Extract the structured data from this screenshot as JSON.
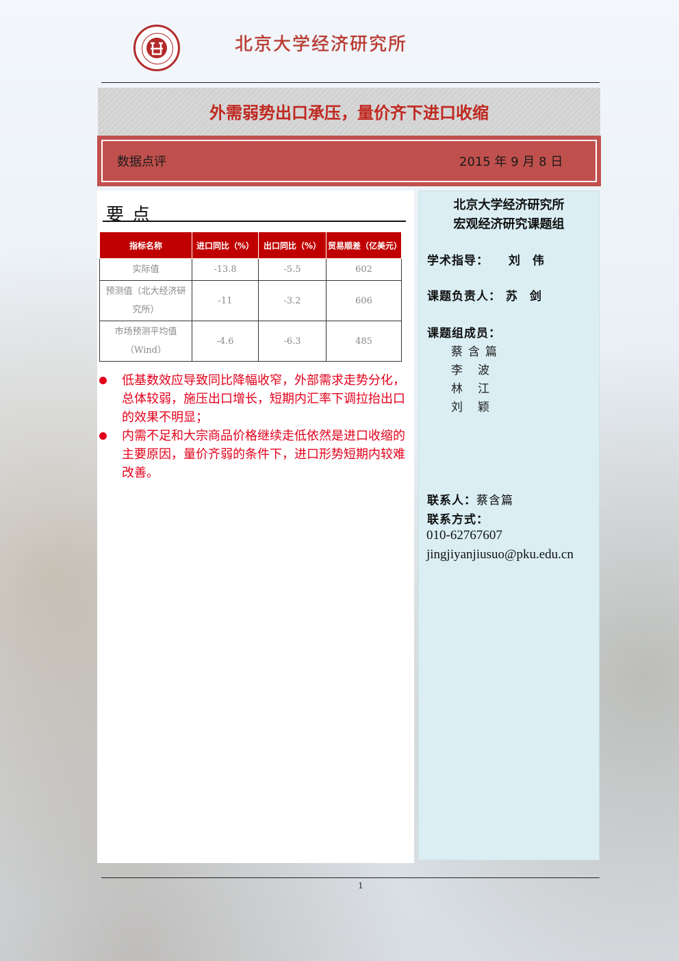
{
  "header": {
    "brand": "北京大学经济研究所"
  },
  "title": "外需弱势出口承压，量价齐下进口收缩",
  "band": {
    "label": "数据点评",
    "date": "2015 年 9 月 8 日"
  },
  "key_points": {
    "heading": "要点",
    "table": {
      "headers": [
        "指标名称",
        "进口同比（%）",
        "出口同比（%）",
        "贸易顺差（亿美元）"
      ],
      "rows": [
        {
          "name": "实际值",
          "import": "-13.8",
          "export": "-5.5",
          "surplus": "602"
        },
        {
          "name": "预测值（北大经济研究所）",
          "import": "-11",
          "export": "-3.2",
          "surplus": "606"
        },
        {
          "name": "市场预测平均值（Wind）",
          "import": "-4.6",
          "export": "-6.3",
          "surplus": "485"
        }
      ]
    },
    "bullets": [
      "低基数效应导致同比降幅收窄，外部需求走势分化，总体较弱，施压出口增长，短期内汇率下调拉抬出口的效果不明显；",
      "内需不足和大宗商品价格继续走低依然是进口收缩的主要原因，量价齐弱的条件下，进口形势短期内较难改善。"
    ]
  },
  "sidebar": {
    "org_line1": "北京大学经济研究所",
    "org_line2": "宏观经济研究课题组",
    "advisor_label": "学术指导：",
    "advisor_name": "刘 伟",
    "lead_label": "课题负责人：",
    "lead_name": "苏 剑",
    "members_label": "课题组成员：",
    "members": [
      "蔡含篇",
      "李波",
      "林江",
      "刘颖"
    ],
    "contact_label": "联系人：",
    "contact_name": "蔡含篇",
    "contact_method_label": "联系方式：",
    "phone": "010-62767607",
    "email": "jingjiyanjiusuo@pku.edu.cn"
  },
  "footer": {
    "page_number": "1"
  },
  "colors": {
    "brand_red": "#c0352d",
    "band_red": "#c0504d",
    "table_header_red": "#c00000",
    "bullet_red": "#e3001b",
    "sidebar_blue": "#daeef3"
  }
}
